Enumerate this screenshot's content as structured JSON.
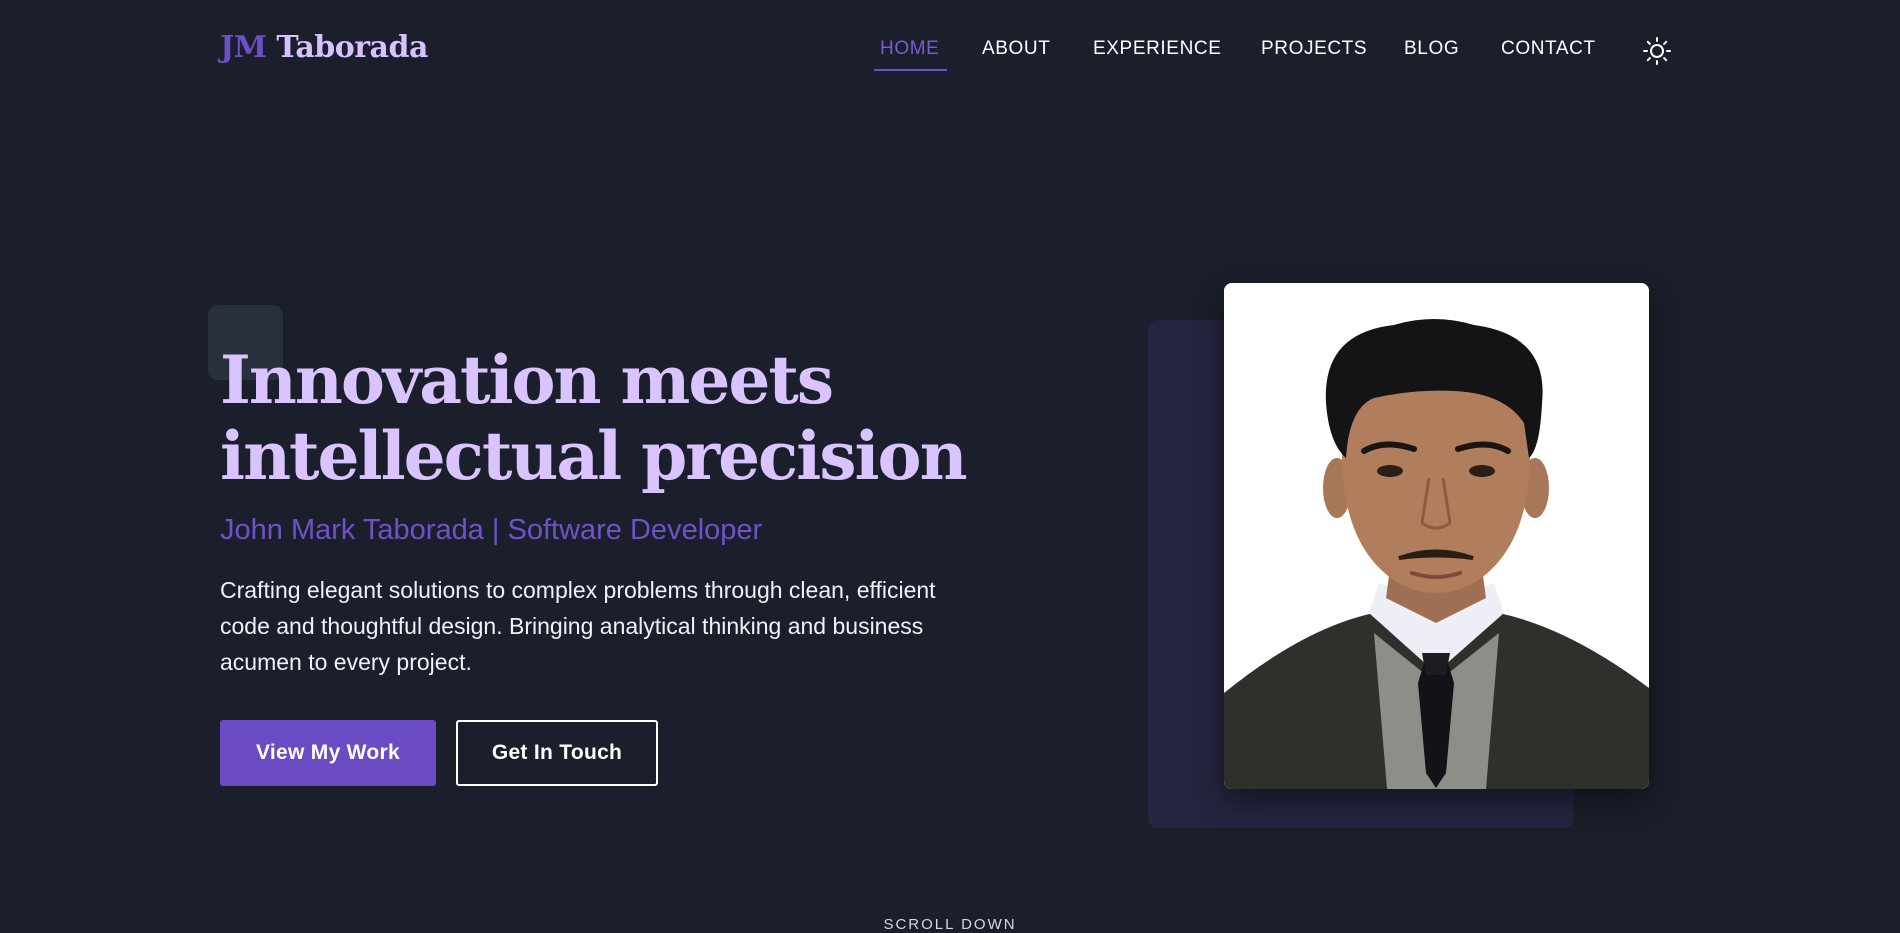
{
  "header": {
    "logo_initials": "JM",
    "logo_name": "Taborada",
    "nav": [
      {
        "label": "HOME",
        "active": true
      },
      {
        "label": "ABOUT",
        "active": false
      },
      {
        "label": "EXPERIENCE",
        "active": false
      },
      {
        "label": "PROJECTS",
        "active": false
      },
      {
        "label": "BLOG",
        "active": false
      },
      {
        "label": "CONTACT",
        "active": false
      }
    ],
    "theme_toggle_icon": "sun-icon"
  },
  "hero": {
    "headline_line1": "Innovation meets",
    "headline_line2": "intellectual precision",
    "subtitle": "John Mark Taborada | Software Developer",
    "description": "Crafting elegant solutions to complex problems through clean, efficient code and thoughtful design. Bringing analytical thinking and business acumen to every project.",
    "primary_button": "View My Work",
    "secondary_button": "Get In Touch",
    "portrait_icon": "portrait-photo"
  },
  "scroll_hint": "SCROLL DOWN",
  "colors": {
    "background": "#1b1f2b",
    "accent": "#6a4bc4",
    "headline": "#d9c4ff",
    "nav_active": "#7a5ad6"
  }
}
